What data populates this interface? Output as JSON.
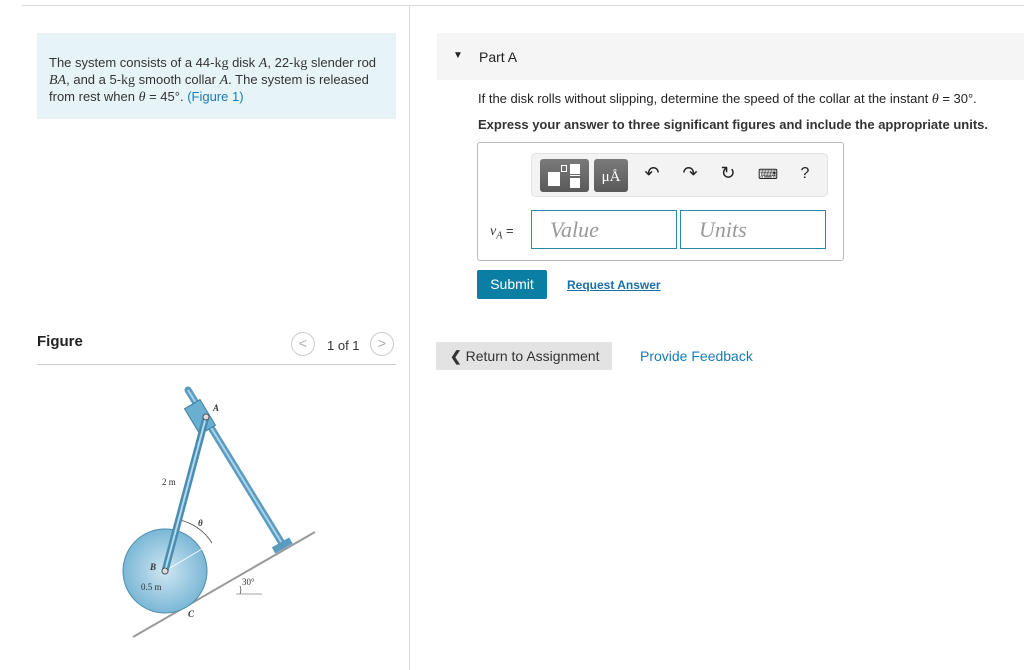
{
  "problem": {
    "text_prefix": "The system consists of a 44-",
    "kg1": "kg",
    "text_2": " disk ",
    "A1": "A",
    "text_3": ", 22-",
    "kg2": "kg",
    "text_4": " slender rod ",
    "BA": "BA",
    "text_5": ", and a 5-",
    "kg3": "kg",
    "text_6": " smooth collar ",
    "A2": "A",
    "text_7": ". The system is released from rest when ",
    "theta": "θ",
    "text_8": " = 45°. ",
    "figure_link": "(Figure 1)"
  },
  "figure": {
    "title": "Figure",
    "pager": "1 of 1",
    "prev": "<",
    "next": ">",
    "labels": {
      "A": "A",
      "B": "B",
      "C": "C",
      "rod": "2 m",
      "radius": "0.5 m",
      "theta": "θ",
      "angle": "30°"
    }
  },
  "part": {
    "label": "Part A",
    "question_prefix": "If the disk rolls without slipping, determine the speed of the collar at the instant ",
    "theta": "θ",
    "question_suffix": " = 30°.",
    "instruction": "Express your answer to three significant figures and include the appropriate units."
  },
  "answer": {
    "variable": "v",
    "subscript": "A",
    "equals": " =",
    "value_placeholder": "Value",
    "units_placeholder": "Units",
    "toolbar": {
      "units_btn": "μÅ",
      "help": "?"
    }
  },
  "buttons": {
    "submit": "Submit",
    "request": "Request Answer",
    "return": "Return to Assignment",
    "feedback": "Provide Feedback"
  },
  "colors": {
    "accent": "#0b7ea3",
    "problem_bg": "#e7f4f7",
    "link": "#1a7bb9"
  }
}
